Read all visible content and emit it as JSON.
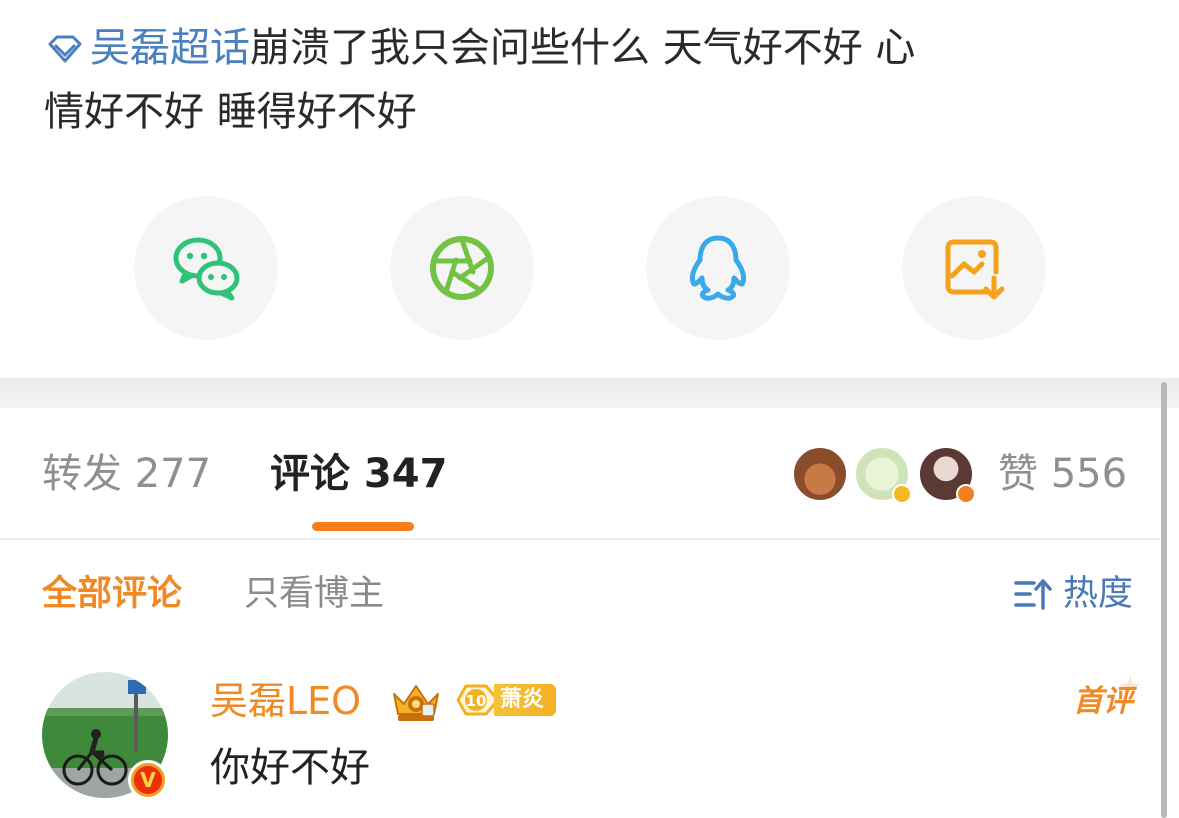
{
  "post": {
    "topic": "吴磊超话",
    "topic_icon": "diamond-icon",
    "text_line1": "崩溃了我只会问些什么 天气好不好 心",
    "text_line2": "情好不好 睡得好不好"
  },
  "share": [
    {
      "name": "wechat",
      "icon": "wechat-icon",
      "color": "#2fc37a"
    },
    {
      "name": "moments",
      "icon": "shutter-icon",
      "color": "#72c244"
    },
    {
      "name": "qq",
      "icon": "penguin-icon",
      "color": "#3aa9ea"
    },
    {
      "name": "save-image",
      "icon": "image-download-icon",
      "color": "#f4a21b"
    }
  ],
  "tabs": {
    "repost": "转发 277",
    "comment": "评论 347",
    "like": "赞 556"
  },
  "filters": {
    "all": "全部评论",
    "author_only": "只看博主",
    "sort": "热度"
  },
  "comment": {
    "username": "吴磊LEO",
    "fan_level": "10",
    "fan_name": "萧炎",
    "badge": "首评",
    "text": "你好不好",
    "verified_mark": "V"
  },
  "colors": {
    "accent": "#fa7d1b",
    "topic_blue": "#4a7fc0",
    "sort_blue": "#4a79b6",
    "muted": "#8f8f8f"
  }
}
